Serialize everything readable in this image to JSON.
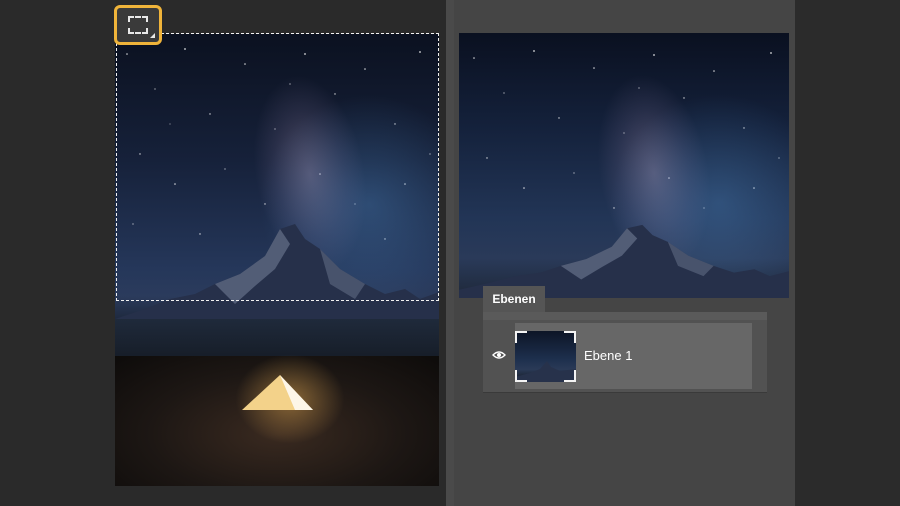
{
  "toolbar": {
    "active_tool_icon": "rectangular-marquee-icon",
    "accent_color": "#f0b43a"
  },
  "layers_panel": {
    "tab_label": "Ebenen",
    "layers": [
      {
        "name": "Ebene 1",
        "visible": true
      }
    ]
  },
  "colors": {
    "workspace": "#2b2b2b",
    "panel": "#454545",
    "layer_selected": "#676767"
  }
}
